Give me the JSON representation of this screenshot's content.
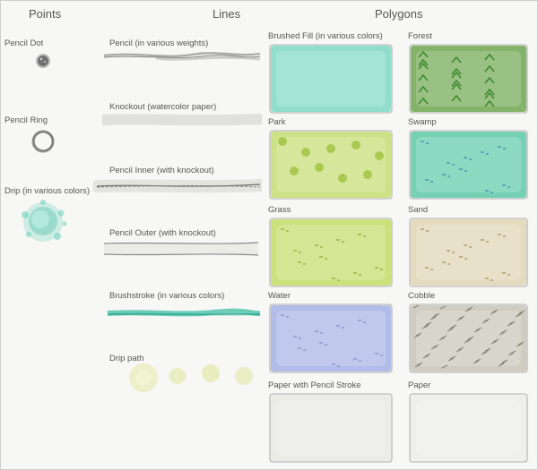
{
  "headings": {
    "points": "Points",
    "lines": "Lines",
    "polygons": "Polygons"
  },
  "points": [
    {
      "label": "Pencil Dot",
      "icon": "pencil-dot-icon"
    },
    {
      "label": "Pencil Ring",
      "icon": "pencil-ring-icon"
    },
    {
      "label": "Drip (in various colors)",
      "icon": "drip-point-icon"
    }
  ],
  "lines": [
    {
      "label": "Pencil (in various weights)"
    },
    {
      "label": "Knockout (watercolor paper)"
    },
    {
      "label": "Pencil Inner (with knockout)"
    },
    {
      "label": "Pencil Outer (with knockout)"
    },
    {
      "label": "Brushstroke (in various colors)"
    },
    {
      "label": "Drip path"
    }
  ],
  "polygons": [
    {
      "label": "Brushed Fill (in various colors)",
      "color": "#7fd9c4"
    },
    {
      "label": "Forest",
      "color": "#6fa850"
    },
    {
      "label": "Park",
      "color": "#c5dd72"
    },
    {
      "label": "Swamp",
      "color": "#5fcaa8"
    },
    {
      "label": "Grass",
      "color": "#c4dc66"
    },
    {
      "label": "Sand",
      "color": "#e0d5b4"
    },
    {
      "label": "Water",
      "color": "#a6b2e6"
    },
    {
      "label": "Cobble",
      "color": "#c9c4b8"
    },
    {
      "label": "Paper with Pencil Stroke",
      "color": "#e9e9e5"
    },
    {
      "label": "Paper",
      "color": "#ececea"
    }
  ]
}
